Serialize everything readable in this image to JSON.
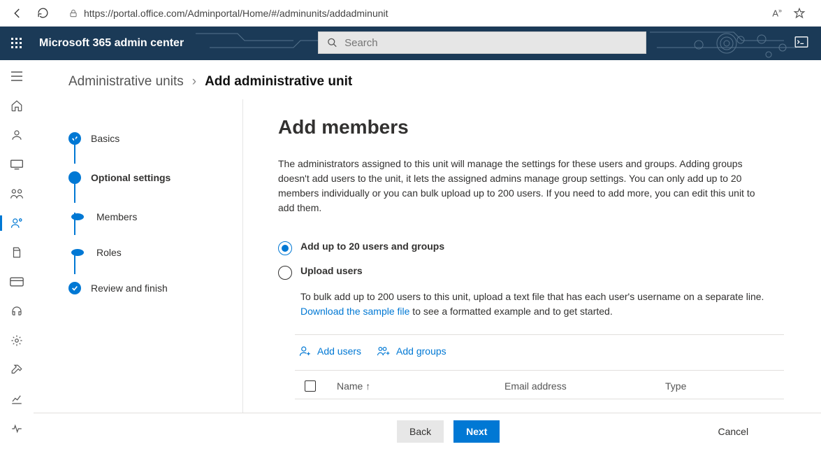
{
  "browser": {
    "url": "https://portal.office.com/Adminportal/Home/#/adminunits/addadminunit"
  },
  "banner": {
    "title": "Microsoft 365 admin center",
    "search_placeholder": "Search"
  },
  "breadcrumb": {
    "root": "Administrative units",
    "current": "Add administrative unit"
  },
  "stepper": {
    "items": [
      {
        "label": "Basics",
        "state": "done"
      },
      {
        "label": "Optional settings",
        "state": "current"
      },
      {
        "label": "Members",
        "state": "upcoming"
      },
      {
        "label": "Roles",
        "state": "upcoming"
      },
      {
        "label": "Review and finish",
        "state": "done"
      }
    ]
  },
  "page": {
    "title": "Add members",
    "description": "The administrators assigned to this unit will manage the settings for these users and groups. Adding groups doesn't add users to the unit, it lets the assigned admins manage group settings. You can only add up to 20 members individually or you can bulk upload up to 200 users. If you need to add more, you can edit this unit to add them.",
    "radio": {
      "option1": "Add up to 20 users and groups",
      "option2": "Upload users",
      "upload_hint_pre": "To bulk add up to 200 users to this unit, upload a text file that has each user's username on a separate line. ",
      "upload_link": "Download the sample file",
      "upload_hint_post": " to see a formatted example and to get started."
    },
    "actions": {
      "add_users": "Add users",
      "add_groups": "Add groups"
    },
    "table": {
      "col_name": "Name ↑",
      "col_email": "Email address",
      "col_type": "Type"
    },
    "footer": {
      "back": "Back",
      "next": "Next",
      "cancel": "Cancel"
    }
  }
}
